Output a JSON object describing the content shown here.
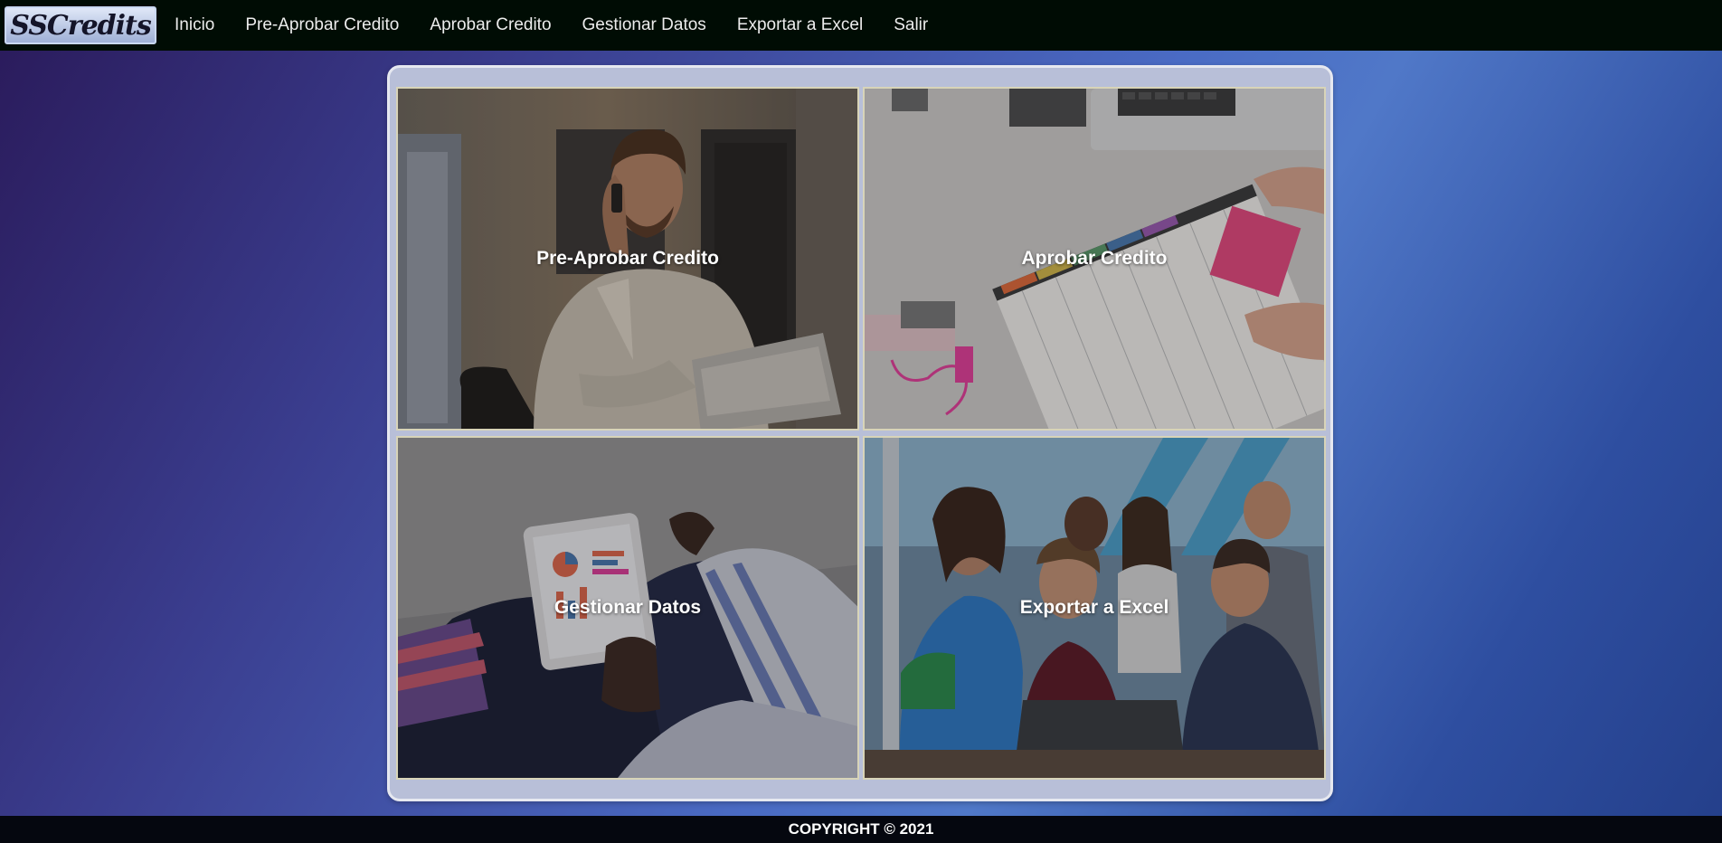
{
  "logo": {
    "text": "SSCredits"
  },
  "nav": [
    {
      "label": "Inicio"
    },
    {
      "label": "Pre-Aprobar Credito"
    },
    {
      "label": "Aprobar Credito"
    },
    {
      "label": "Gestionar Datos"
    },
    {
      "label": "Exportar a Excel"
    },
    {
      "label": "Salir"
    }
  ],
  "tiles": [
    {
      "label": "Pre-Aprobar Credito"
    },
    {
      "label": "Aprobar Credito"
    },
    {
      "label": "Gestionar Datos"
    },
    {
      "label": "Exportar a Excel"
    }
  ],
  "footer": {
    "copyright": "COPYRIGHT © 2021"
  }
}
